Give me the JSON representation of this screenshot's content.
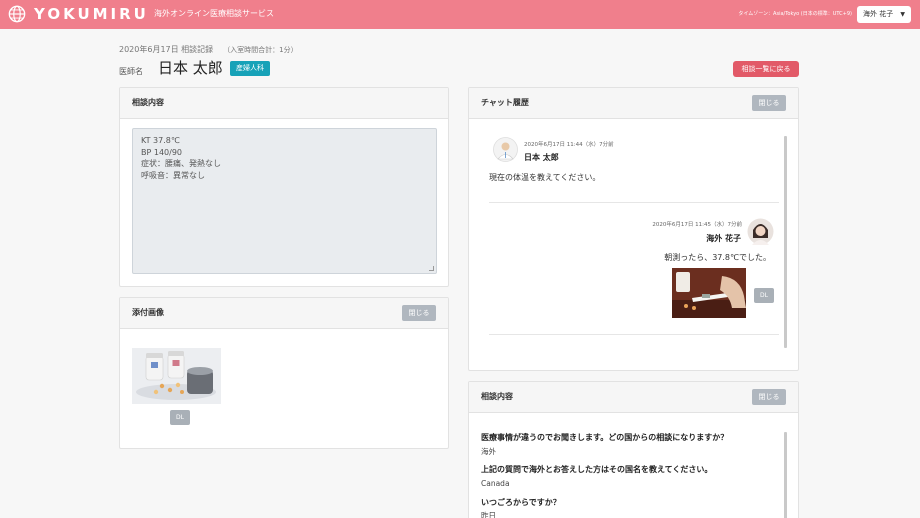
{
  "topbar": {
    "logo_text": "YOKUMIRU",
    "service_name": "海外オンライン医療相談サービス",
    "timezone": "タイムゾーン：Asia/Tokyo (日本の標準：UTC+9)",
    "user_name": "海外 花子"
  },
  "header": {
    "date_label": "2020年6月17日 相談記録",
    "total_time": "（入室時間合計：1分）",
    "doctor_label": "医師名",
    "doctor_name": "日本 太郎",
    "specialty_badge": "産婦人科",
    "back_button": "相談一覧に戻る"
  },
  "consultation_note": {
    "title": "相談内容",
    "lines": [
      "KT 37.8℃",
      "BP 140/90",
      "症状：腰痛、発熱なし",
      "呼吸音：異常なし"
    ]
  },
  "attachments": {
    "title": "添付画像",
    "close_label": "閉じる",
    "dl_label": "DL"
  },
  "chat": {
    "title": "チャット履歴",
    "close_label": "閉じる",
    "messages": [
      {
        "meta": "2020年6月17日 11:44（水）7分前",
        "name": "日本 太郎",
        "text": "現在の体温を教えてください。"
      },
      {
        "meta": "2020年6月17日 11:45（水）7分前",
        "name": "海外 花子",
        "text": "朝測ったら、37.8℃でした。",
        "dl_label": "DL"
      }
    ]
  },
  "qa": {
    "title": "相談内容",
    "close_label": "閉じる",
    "items": [
      {
        "q": "医療事情が違うのでお聞きします。どの国からの相談になりますか？",
        "a": "海外"
      },
      {
        "q": "上記の質問で海外とお答えした方はその国名を教えてください。",
        "a": "Canada"
      },
      {
        "q": "いつごろからですか？",
        "a": "昨日"
      }
    ]
  },
  "colors": {
    "brand": "#f07f8c",
    "back_button": "#e25a68",
    "badge": "#17a2b8"
  },
  "icons": {
    "logo": "globe-icon",
    "user_menu": "chevron-down-icon"
  }
}
